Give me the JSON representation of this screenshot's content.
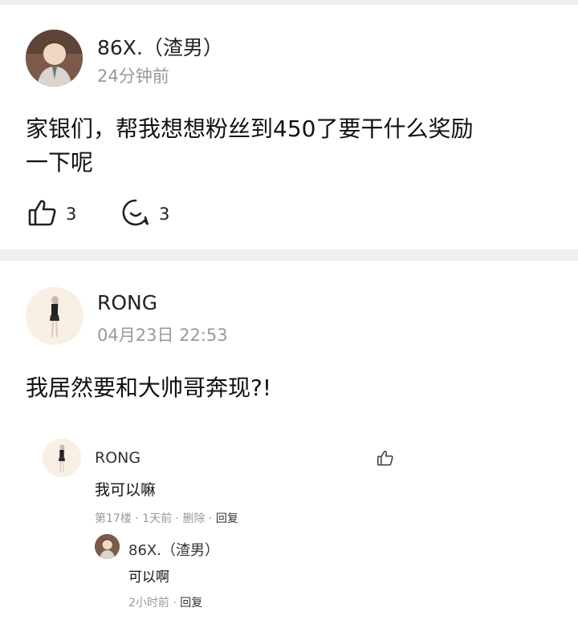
{
  "post1": {
    "author": "86X.（渣男）",
    "time": "24分钟前",
    "content_line1": "家银们，帮我想想粉丝到450了要干什么奖励",
    "content_line2": "一下呢",
    "likes": "3",
    "comments": "3"
  },
  "post2": {
    "author": "RONG",
    "time": "04月23日 22:53",
    "content": "我居然要和大帅哥奔现?!"
  },
  "reply1": {
    "author": "RONG",
    "text": "我可以嘛",
    "floor": "第17楼",
    "time": "1天前",
    "delete": "删除",
    "reply": "回复"
  },
  "reply2": {
    "author": "86X.（渣男）",
    "text": "可以啊",
    "time": "2小时前",
    "reply": "回复"
  }
}
